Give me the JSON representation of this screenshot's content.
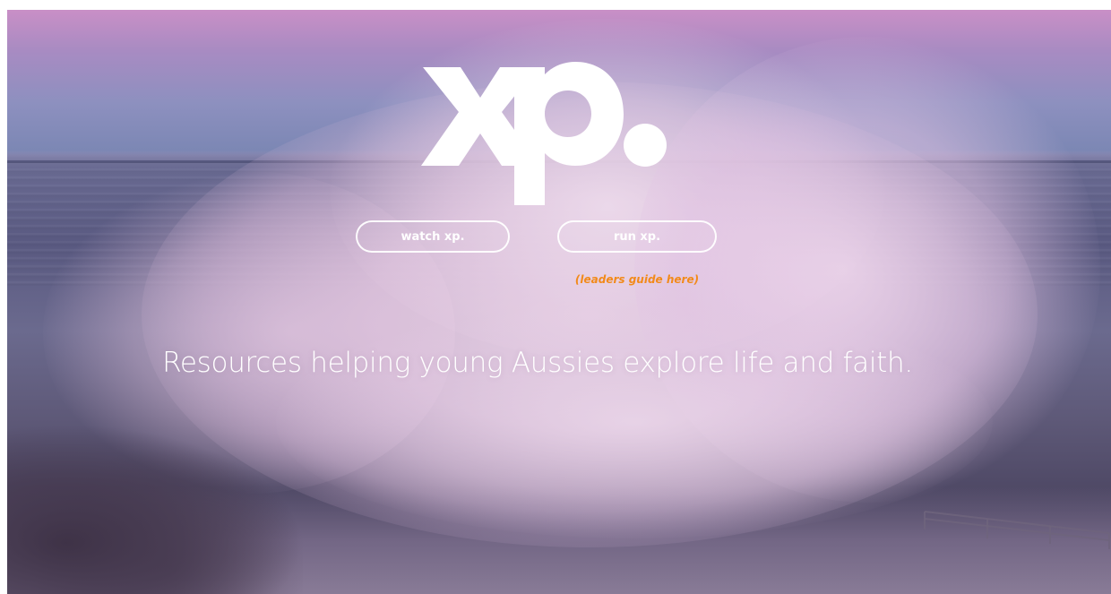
{
  "hero": {
    "logo_text": "xp.",
    "tagline": "Resources helping young Aussies explore life and faith."
  },
  "buttons": {
    "watch_label": "watch xp.",
    "run_label": "run xp."
  },
  "links": {
    "leaders_guide_label": "(leaders guide here)"
  },
  "colors": {
    "sky_top": "#c98fc6",
    "sky_bottom": "#7c87b4",
    "sea": "#5a5a82",
    "spray": "#ecd6e8",
    "button_border": "#ffffff",
    "link_accent": "#f28a1a",
    "text": "#ffffff"
  }
}
